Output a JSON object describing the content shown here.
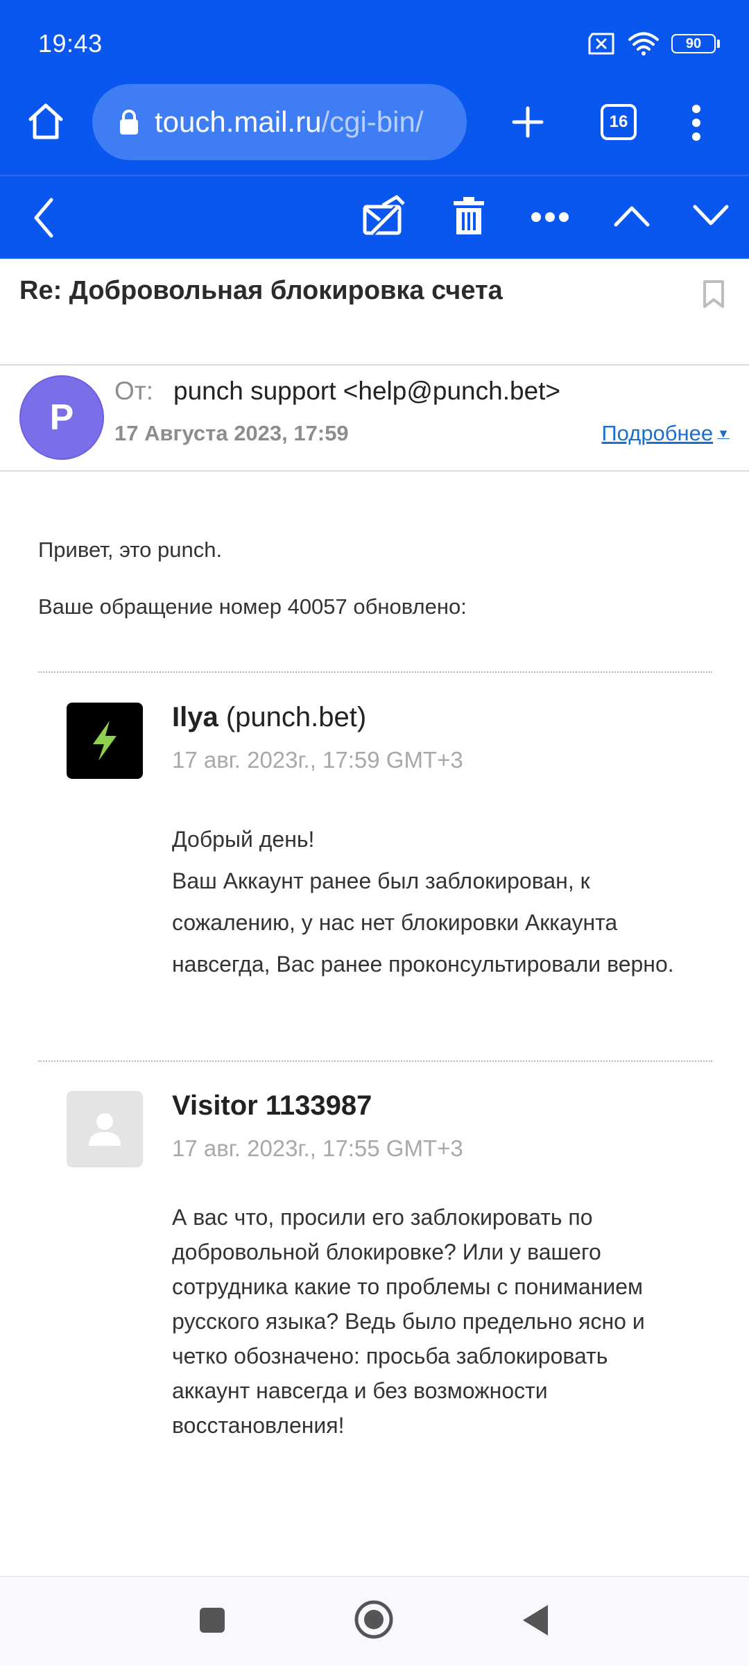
{
  "status_bar": {
    "time": "19:43",
    "battery": "90"
  },
  "browser": {
    "url_host": "touch.mail.ru",
    "url_path": "/cgi-bin/",
    "tabs_count": "16"
  },
  "email": {
    "subject": "Re: Добровольная блокировка счета",
    "sender_initial": "P",
    "from_label": "От:",
    "from_value": "punch support <help@punch.bet>",
    "date": "17 Августа 2023, 17:59",
    "details_label": "Подробнее",
    "greeting": "Привет, это punch.",
    "intro": "Ваше обращение номер 40057 обновлено:",
    "messages": [
      {
        "author_name": "Ilya",
        "author_suffix": "(punch.bet)",
        "date": "17 авг. 2023г., 17:59 GMT+3",
        "lines": [
          "Добрый день!",
          "Ваш Аккаунт ранее был заблокирован, к",
          "сожалению, у нас нет блокировки Аккаунта",
          "навсегда, Вас ранее проконсультировали верно."
        ]
      },
      {
        "author_name": "Visitor 1133987",
        "date": "17 авг. 2023г., 17:55 GMT+3",
        "lines": [
          "А вас что, просили его заблокировать по",
          "добровольной блокировке? Или у вашего",
          "сотрудника какие то проблемы с пониманием",
          "русского языка? Ведь было предельно ясно и",
          "четко обозначено: просьба заблокировать",
          "аккаунт навсегда и без возможности",
          "восстановления!"
        ]
      }
    ]
  },
  "colors": {
    "primary": "#0a57f0",
    "avatar": "#7a6ee9",
    "link": "#1a6fd1"
  }
}
